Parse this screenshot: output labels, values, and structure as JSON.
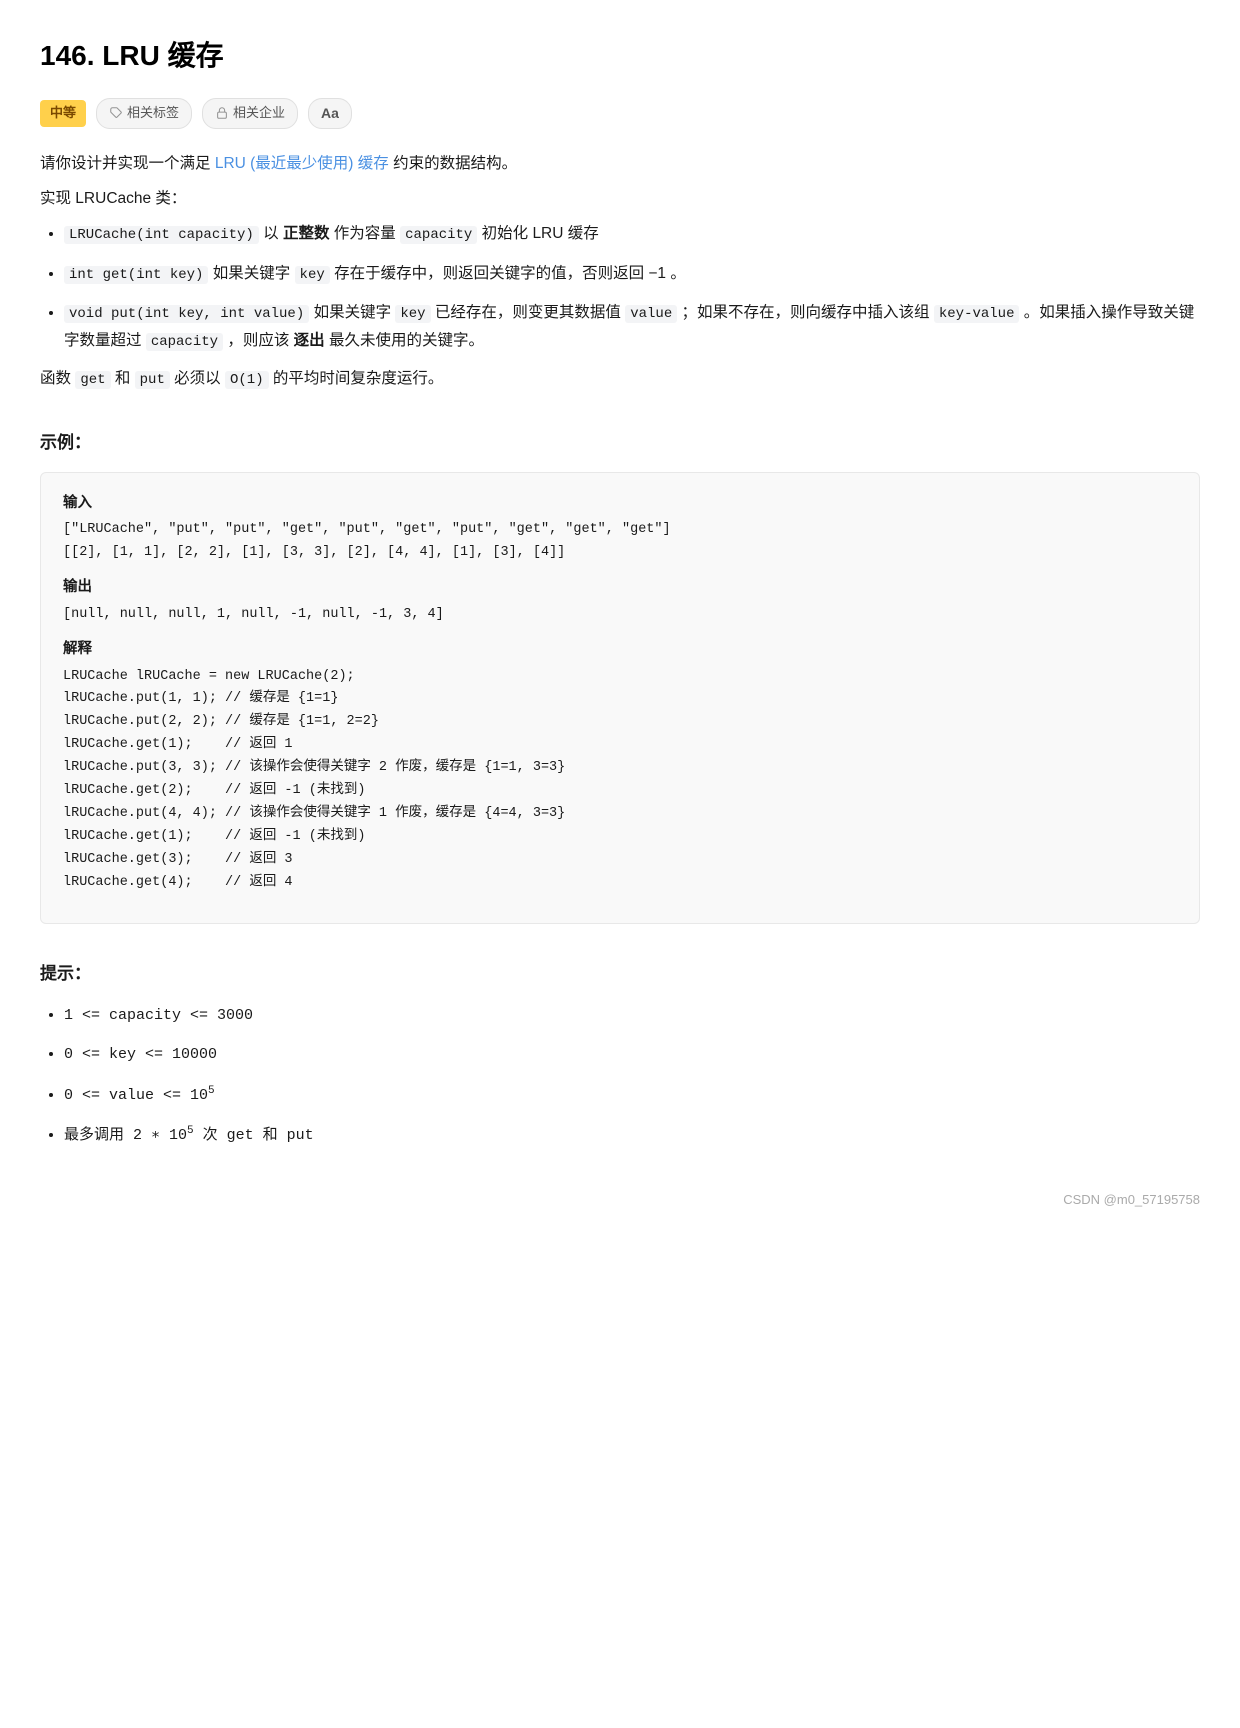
{
  "title": "146. LRU 缓存",
  "tags": {
    "difficulty": "中等",
    "related_tags": "相关标签",
    "related_company": "相关企业",
    "font_icon": "Aa"
  },
  "description": {
    "intro": "请你设计并实现一个满足",
    "link_text": "LRU (最近最少使用) 缓存",
    "intro2": "约束的数据结构。",
    "impl_label": "实现 LRUCache 类：",
    "items": [
      {
        "code": "LRUCache(int capacity)",
        "text": " 以 正整数 作为容量 capacity 初始化 LRU 缓存"
      },
      {
        "code": "int get(int key)",
        "text": " 如果关键字 key 存在于缓存中，则返回关键字的值，否则返回 −1 。"
      },
      {
        "code_prefix": "void put(int key, int value)",
        "text": " 如果关键字 key 已经存在，则变更其数据值 value ；如果不存在，则向缓存中插入该组 key-value 。如果插入操作导致关键字数量超过 capacity ，则应该 逐出 最久未使用的关键字。"
      }
    ],
    "complexity": "函数 get 和 put 必须以 O(1) 的平均时间复杂度运行。"
  },
  "example": {
    "section_title": "示例：",
    "input_label": "输入",
    "input_line1": "[\"LRUCache\", \"put\", \"put\", \"get\", \"put\", \"get\", \"put\", \"get\", \"get\", \"get\"]",
    "input_line2": "[[2], [1, 1], [2, 2], [1], [3, 3], [2], [4, 4], [1], [3], [4]]",
    "output_label": "输出",
    "output_line": "[null, null, null, 1, null, -1, null, -1, 3, 4]",
    "explain_label": "解释",
    "explain_lines": [
      "LRUCache lRUCache = new LRUCache(2);",
      "lRUCache.put(1, 1); // 缓存是 {1=1}",
      "lRUCache.put(2, 2); // 缓存是 {1=1, 2=2}",
      "lRUCache.get(1);    // 返回 1",
      "lRUCache.put(3, 3); // 该操作会使得关键字 2 作废，缓存是 {1=1, 3=3}",
      "lRUCache.get(2);    // 返回 -1 (未找到)",
      "lRUCache.put(4, 4); // 该操作会使得关键字 1 作废，缓存是 {4=4, 3=3}",
      "lRUCache.get(1);    // 返回 -1 (未找到)",
      "lRUCache.get(3);    // 返回 3",
      "lRUCache.get(4);    // 返回 4"
    ]
  },
  "hints": {
    "section_title": "提示：",
    "items": [
      "1 <= capacity <= 3000",
      "0 <= key <= 10000",
      "0 <= value <= 10⁵",
      "最多调用 2 ∗ 10⁵ 次 get 和 put"
    ]
  },
  "footer": "CSDN @m0_57195758"
}
